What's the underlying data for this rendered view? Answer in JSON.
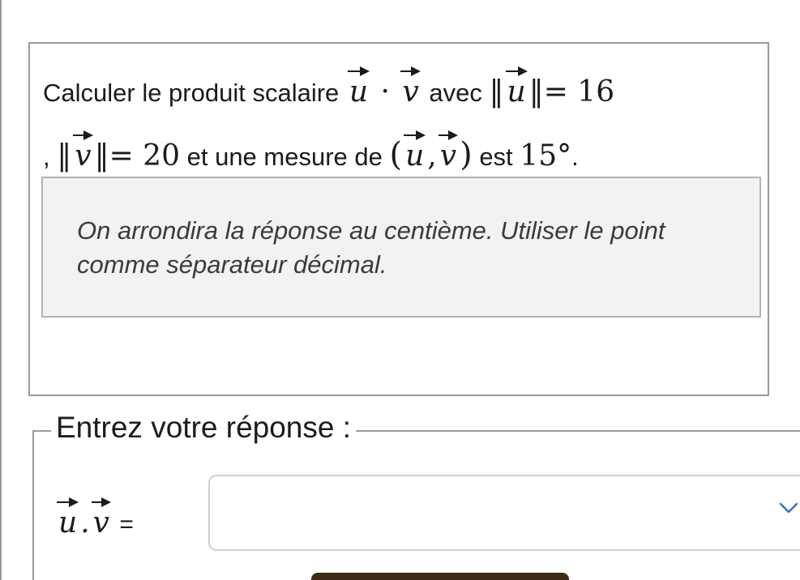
{
  "question": {
    "line1": {
      "prefix": "Calculer le produit scalaire ",
      "vec_u": "u",
      "dot": " · ",
      "vec_v": "v",
      "middle": " avec ",
      "norm_open": "‖",
      "norm_close": "‖",
      "eq_value": "= 16"
    },
    "line2": {
      "comma": ", ",
      "norm_open": "‖",
      "vec_v": "v",
      "norm_close": "‖",
      "eq_value": "= 20",
      "middle": " et une mesure de ",
      "paren_open": "(",
      "vec_u": "u",
      "sep": ",",
      "vec_v2": "v",
      "paren_close": ")",
      "suffix": " est ",
      "angle": "15°",
      "period": "."
    }
  },
  "note": {
    "text": "On arrondira la réponse au centième. Utiliser le point comme séparateur décimal."
  },
  "answer": {
    "legend": "Entrez votre réponse :",
    "label_vec_u": "u",
    "label_dot": ".",
    "label_vec_v": "v",
    "label_equals": " =",
    "selected_value": ""
  },
  "icons": {
    "dropdown": "chevron-down-icon"
  },
  "colors": {
    "chevron": "#2f6fd1",
    "submit_button": "#3d2b16",
    "note_background": "#f2f2f2"
  }
}
